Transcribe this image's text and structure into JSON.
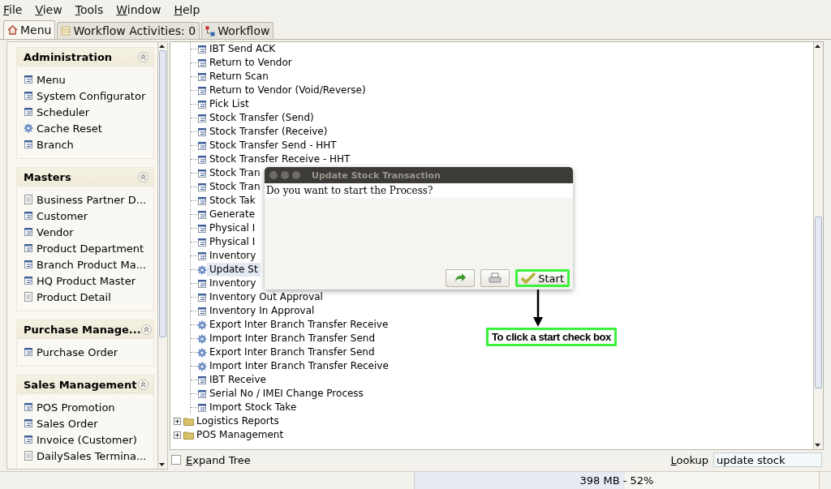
{
  "menu_bar": [
    "File",
    "View",
    "Tools",
    "Window",
    "Help"
  ],
  "tabs": [
    {
      "label": "Menu",
      "kind": "home",
      "selected": true
    },
    {
      "label": "Workflow Activities: 0",
      "kind": "list",
      "selected": false
    },
    {
      "label": "Workflow",
      "kind": "flow",
      "selected": false
    }
  ],
  "sidebar": {
    "sections": [
      {
        "title": "Administration",
        "expanded": true,
        "items": [
          {
            "label": "Menu",
            "kind": "form"
          },
          {
            "label": "System Configurator",
            "kind": "form"
          },
          {
            "label": "Scheduler",
            "kind": "form"
          },
          {
            "label": "Cache Reset",
            "kind": "process"
          },
          {
            "label": "Branch",
            "kind": "form"
          }
        ]
      },
      {
        "title": "Masters",
        "expanded": true,
        "items": [
          {
            "label": "Business Partner D...",
            "kind": "report"
          },
          {
            "label": "Customer",
            "kind": "form"
          },
          {
            "label": "Vendor",
            "kind": "form"
          },
          {
            "label": "Product Department",
            "kind": "form"
          },
          {
            "label": "Branch Product Ma...",
            "kind": "form"
          },
          {
            "label": "HQ Product Master",
            "kind": "form"
          },
          {
            "label": "Product Detail",
            "kind": "report"
          }
        ]
      },
      {
        "title": "Purchase Manage...",
        "expanded": true,
        "items": [
          {
            "label": "Purchase Order",
            "kind": "form"
          }
        ]
      },
      {
        "title": "Sales Management",
        "expanded": true,
        "items": [
          {
            "label": "POS Promotion",
            "kind": "form"
          },
          {
            "label": "Sales Order",
            "kind": "form"
          },
          {
            "label": "Invoice (Customer)",
            "kind": "form"
          },
          {
            "label": "DailySales Termina...",
            "kind": "report"
          }
        ]
      }
    ]
  },
  "tree": {
    "items": [
      {
        "label": "IBT Send ACK",
        "kind": "form",
        "selected": false
      },
      {
        "label": "Return to Vendor",
        "kind": "form",
        "selected": false
      },
      {
        "label": "Return Scan",
        "kind": "form",
        "selected": false
      },
      {
        "label": "Return to Vendor (Void/Reverse)",
        "kind": "form",
        "selected": false
      },
      {
        "label": "Pick List",
        "kind": "form",
        "selected": false
      },
      {
        "label": "Stock Transfer (Send)",
        "kind": "form",
        "selected": false
      },
      {
        "label": "Stock Transfer (Receive)",
        "kind": "form",
        "selected": false
      },
      {
        "label": "Stock Transfer Send - HHT",
        "kind": "form",
        "selected": false
      },
      {
        "label": "Stock Transfer Receive - HHT",
        "kind": "form",
        "selected": false
      },
      {
        "label": "Stock Tran",
        "kind": "form",
        "selected": false
      },
      {
        "label": "Stock Tran",
        "kind": "form",
        "selected": false
      },
      {
        "label": "Stock Tak",
        "kind": "form",
        "selected": false
      },
      {
        "label": "Generate",
        "kind": "form",
        "selected": false
      },
      {
        "label": "Physical I",
        "kind": "form",
        "selected": false
      },
      {
        "label": "Physical I",
        "kind": "form",
        "selected": false
      },
      {
        "label": "Inventory",
        "kind": "form",
        "selected": false
      },
      {
        "label": "Update St",
        "kind": "process",
        "selected": true
      },
      {
        "label": "Inventory",
        "kind": "form",
        "selected": false
      },
      {
        "label": "Inventory Out Approval",
        "kind": "form",
        "selected": false
      },
      {
        "label": "Inventory In Approval",
        "kind": "form",
        "selected": false
      },
      {
        "label": "Export Inter Branch Transfer Receive",
        "kind": "process",
        "selected": false
      },
      {
        "label": "Import Inter Branch Transfer Send",
        "kind": "process",
        "selected": false
      },
      {
        "label": "Export Inter Branch Transfer Send",
        "kind": "process",
        "selected": false
      },
      {
        "label": "Import Inter Branch Transfer Receive",
        "kind": "process",
        "selected": false
      },
      {
        "label": "IBT Receive",
        "kind": "form",
        "selected": false
      },
      {
        "label": "Serial No / IMEI Change Process",
        "kind": "form",
        "selected": false
      },
      {
        "label": "Import Stock Take",
        "kind": "form",
        "selected": false
      }
    ],
    "folders": [
      {
        "label": "Logistics Reports",
        "expanded": false
      },
      {
        "label": "POS Management",
        "expanded": false
      }
    ]
  },
  "expand_tree": {
    "label": "Expand Tree",
    "checked": false
  },
  "lookup": {
    "label": "Lookup",
    "value": "update stock"
  },
  "dialog": {
    "title": "Update Stock Transaction",
    "message": "Do you want to start the Process?",
    "buttons": [
      {
        "kind": "redo",
        "highlighted": false
      },
      {
        "kind": "print",
        "highlighted": false
      },
      {
        "kind": "start",
        "label": "Start",
        "highlighted": true
      }
    ]
  },
  "annotation": {
    "text": "To click a start check box"
  },
  "status": {
    "memory": "398 MB - 52%",
    "level": 0.52
  }
}
